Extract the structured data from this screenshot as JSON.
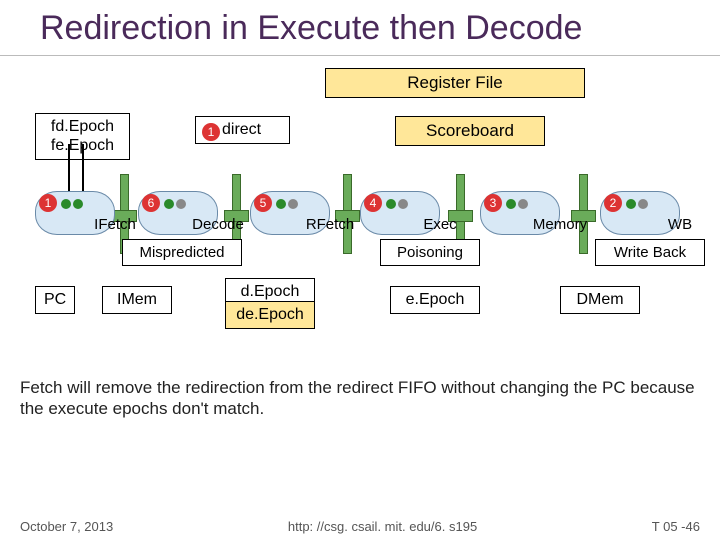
{
  "title": "Redirection in Execute then Decode",
  "boxes": {
    "register_file": "Register File",
    "fd_epoch": "fd.Epoch",
    "fe_epoch": "fe.Epoch",
    "redirect_num": "1",
    "redirect_label": "direct",
    "scoreboard": "Scoreboard",
    "mispredicted": "Mispredicted",
    "poisoning": "Poisoning",
    "write_back": "Write Back",
    "pc": "PC",
    "imem": "IMem",
    "d_epoch": "d.Epoch",
    "de_epoch": "de.Epoch",
    "e_epoch": "e.Epoch",
    "dmem": "DMem"
  },
  "stages": [
    {
      "num": "1",
      "label": "IFetch",
      "dots": [
        "green",
        "green"
      ]
    },
    {
      "num": "6",
      "label": "Decode",
      "dots": [
        "green",
        "grey"
      ]
    },
    {
      "num": "5",
      "label": "RFetch",
      "dots": [
        "green",
        "grey"
      ]
    },
    {
      "num": "4",
      "label": "Exec",
      "dots": [
        "green",
        "grey"
      ]
    },
    {
      "num": "3",
      "label": "Memory",
      "dots": [
        "green",
        "grey"
      ]
    },
    {
      "num": "2",
      "label": "WB",
      "dots": [
        "green",
        "grey"
      ]
    }
  ],
  "caption": "Fetch will remove the redirection from the redirect FIFO without changing the PC because the execute epochs don't match.",
  "footer": {
    "date": "October 7, 2013",
    "url": "http: //csg. csail. mit. edu/6. s195",
    "slide": "T 05 -46"
  }
}
